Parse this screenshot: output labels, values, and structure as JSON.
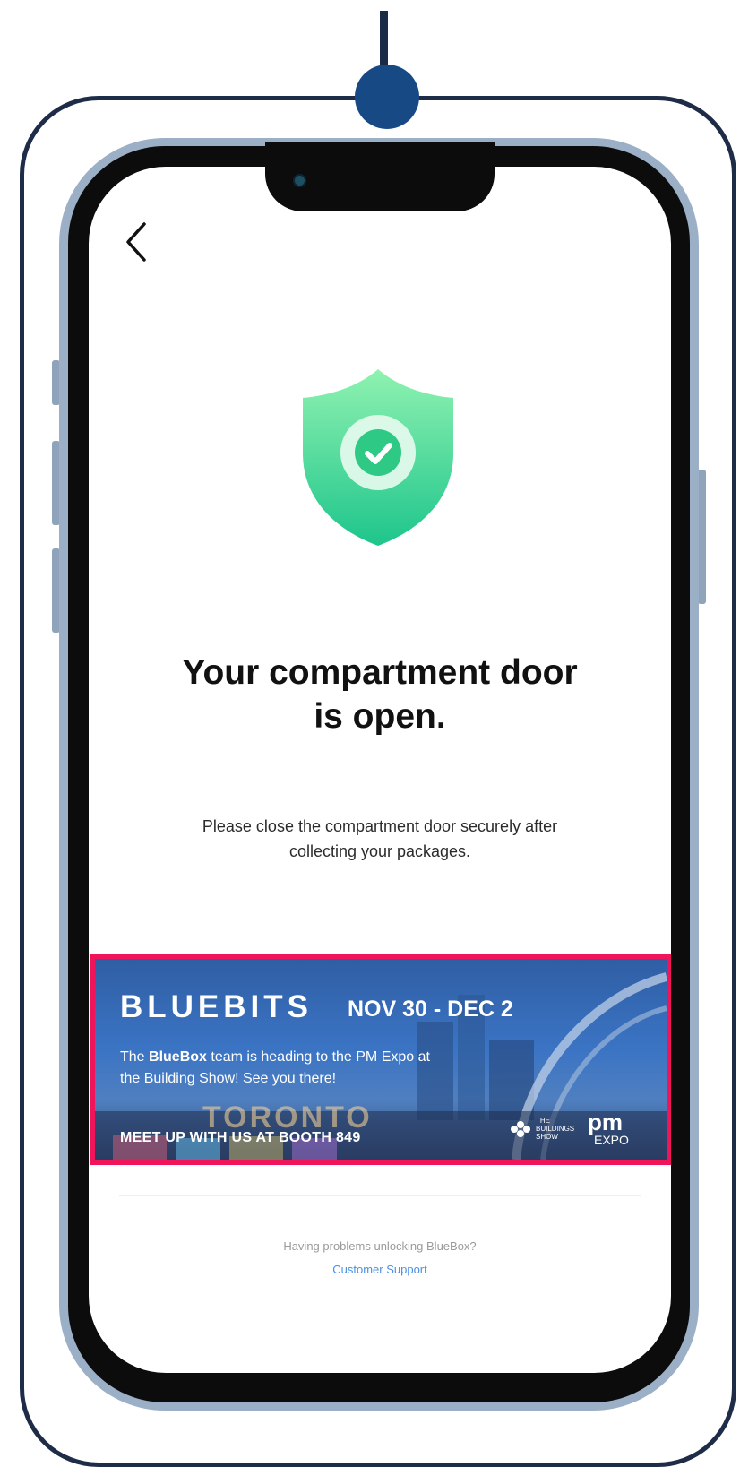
{
  "screen": {
    "back_icon": "chevron-left-icon",
    "status_icon": "shield-check-icon",
    "title_line1": "Your compartment door",
    "title_line2": "is open.",
    "subtitle_line1": "Please close the compartment door securely after",
    "subtitle_line2": "collecting your packages."
  },
  "banner": {
    "brand": "BLUEBITS",
    "dates": "NOV 30 - DEC 2",
    "text_prefix": "The ",
    "text_bold": "BlueBox",
    "text_line1_rest": " team is heading to the PM Expo at",
    "text_line2": "the Building Show! See you there!",
    "city": "TORONTO",
    "cta": "MEET UP WITH US AT BOOTH 849",
    "show_line1": "THE",
    "show_line2": "BUILDINGS",
    "show_line3": "SHOW",
    "pm": "pm",
    "expo": "EXPO",
    "highlight_color": "#f0145a"
  },
  "footer": {
    "help_text": "Having problems unlocking BlueBox?",
    "support_link": "Customer Support"
  },
  "colors": {
    "accent": "#4a90e2",
    "shield_top": "#8cf0ae",
    "shield_bottom": "#22c98d"
  }
}
